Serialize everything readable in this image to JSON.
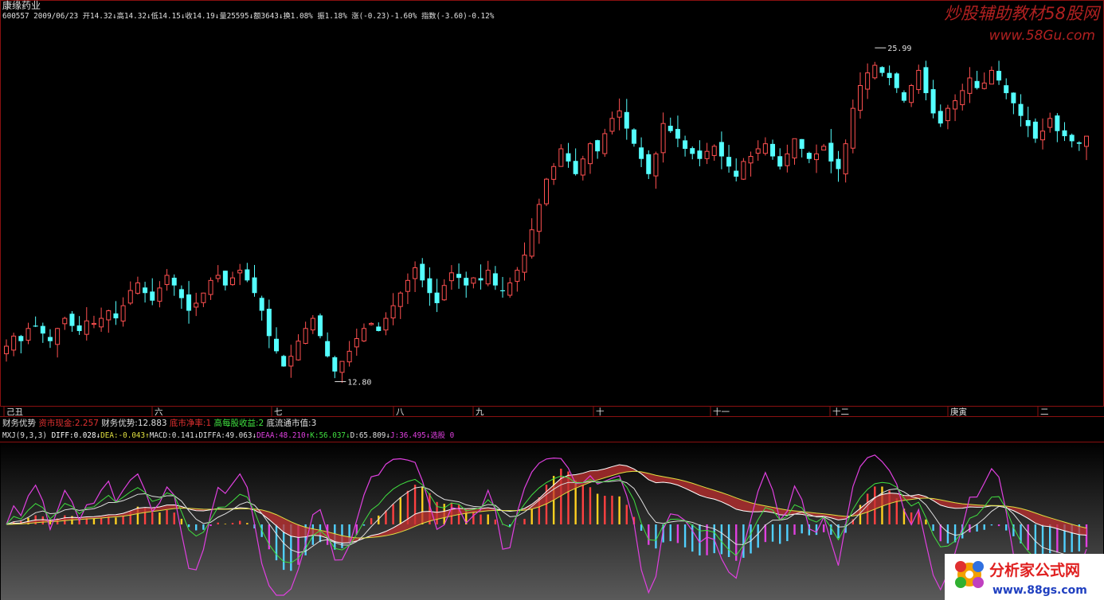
{
  "header": {
    "stock_name": "康缘药业",
    "quote_line": [
      {
        "text": "600557 2009/06/23 ",
        "color": "#e0e0e0"
      },
      {
        "text": "开14.32↓",
        "color": "#e0e0e0"
      },
      {
        "text": "高14.32↓",
        "color": "#e0e0e0"
      },
      {
        "text": "低14.15↓",
        "color": "#e0e0e0"
      },
      {
        "text": "收14.19↓",
        "color": "#e0e0e0"
      },
      {
        "text": "量25595↓",
        "color": "#e0e0e0"
      },
      {
        "text": "额3643↓",
        "color": "#e0e0e0"
      },
      {
        "text": "换1.08% ",
        "color": "#e0e0e0"
      },
      {
        "text": "振1.18% ",
        "color": "#e0e0e0"
      },
      {
        "text": "涨(-0.23)-1.60% ",
        "color": "#e0e0e0"
      },
      {
        "text": "指数(-3.60)-0.12%",
        "color": "#e0e0e0"
      }
    ]
  },
  "watermark": {
    "top_title": "炒股辅助教材58股网",
    "top_url": "www.58Gu.com",
    "bottom_title": "分析家公式网",
    "bottom_url": "www.88gs.com"
  },
  "month_axis": [
    "己丑",
    "六",
    "七",
    "八",
    "九",
    "十",
    "十一",
    "十二",
    "庚寅",
    "二"
  ],
  "finance_line": [
    {
      "text": "财务优势  ",
      "color": "#e0e0e0"
    },
    {
      "text": "资市现金:2.257  ",
      "color": "#e03030"
    },
    {
      "text": "财务优势:12.883  ",
      "color": "#e0e0e0"
    },
    {
      "text": "底市净率:1  ",
      "color": "#e03030"
    },
    {
      "text": "高每股收益:2  ",
      "color": "#40e040"
    },
    {
      "text": "底流通市值:3",
      "color": "#e0e0e0"
    }
  ],
  "indicator_line": [
    {
      "text": "MXJ(9,3,3) ",
      "color": "#e0e0e0"
    },
    {
      "text": "DIFF:0.028↓",
      "color": "#ffffff"
    },
    {
      "text": "DEA:-0.043↑",
      "color": "#e0e040"
    },
    {
      "text": "MACD:0.141↓",
      "color": "#e0e0e0"
    },
    {
      "text": "DIFFA:49.063↓",
      "color": "#e0e0e0"
    },
    {
      "text": "DEAA:48.210↑",
      "color": "#e040e0"
    },
    {
      "text": "K:56.037↓",
      "color": "#40e040"
    },
    {
      "text": "D:65.809↓",
      "color": "#e0e0e0"
    },
    {
      "text": "J:36.495↓",
      "color": "#e040e0"
    },
    {
      "text": "选股 0",
      "color": "#e040e0"
    }
  ],
  "chart_data": [
    {
      "type": "candlestick",
      "price_range": [
        12.0,
        27.0
      ],
      "annotations": [
        {
          "label": "25.99",
          "value": 25.99
        },
        {
          "label": "12.80",
          "value": 12.8
        }
      ],
      "colors": {
        "up": "#ff5050",
        "down": "#54ffff"
      },
      "closes": [
        14.2,
        14.6,
        14.4,
        14.9,
        15.0,
        14.7,
        14.4,
        14.9,
        15.3,
        15.0,
        14.8,
        15.2,
        15.1,
        15.3,
        15.6,
        15.3,
        15.8,
        16.4,
        16.7,
        16.3,
        16.0,
        16.5,
        17.0,
        16.6,
        16.1,
        15.6,
        15.9,
        16.3,
        16.8,
        17.0,
        16.6,
        16.9,
        17.2,
        16.8,
        16.3,
        15.6,
        14.6,
        14.0,
        13.4,
        13.8,
        14.4,
        14.9,
        15.3,
        14.6,
        13.8,
        13.2,
        13.6,
        14.0,
        14.5,
        14.9,
        15.1,
        14.8,
        15.3,
        15.8,
        16.3,
        16.8,
        17.3,
        16.8,
        16.3,
        15.9,
        16.6,
        17.1,
        16.9,
        16.6,
        16.9,
        16.8,
        17.2,
        16.6,
        16.4,
        16.7,
        17.2,
        17.8,
        18.8,
        19.8,
        20.8,
        21.3,
        22.0,
        21.5,
        21.0,
        21.6,
        22.2,
        21.9,
        22.6,
        23.2,
        23.5,
        22.8,
        22.2,
        21.6,
        21.0,
        21.8,
        23.0,
        22.7,
        22.4,
        22.0,
        21.8,
        21.6,
        21.9,
        22.1,
        21.7,
        21.3,
        20.9,
        21.5,
        21.7,
        22.0,
        22.2,
        21.7,
        21.3,
        21.8,
        22.4,
        22.0,
        21.6,
        21.8,
        22.1,
        21.5,
        21.2,
        22.2,
        23.6,
        24.5,
        25.0,
        25.3,
        25.0,
        24.8,
        24.4,
        23.9,
        24.5,
        25.1,
        24.2,
        23.4,
        23.0,
        23.6,
        23.9,
        24.3,
        24.8,
        24.4,
        24.6,
        25.1,
        24.7,
        24.2,
        23.8,
        23.3,
        22.9,
        22.4,
        22.7,
        23.2,
        22.7,
        22.5,
        22.3,
        22.2,
        22.5
      ]
    },
    {
      "type": "indicator",
      "name": "MXJ(9,3,3)",
      "series": [
        {
          "name": "MACD",
          "kind": "bar"
        },
        {
          "name": "DIFF",
          "kind": "line"
        },
        {
          "name": "DEA",
          "kind": "line"
        },
        {
          "name": "K",
          "kind": "line"
        },
        {
          "name": "D",
          "kind": "line"
        },
        {
          "name": "J",
          "kind": "line"
        }
      ]
    }
  ]
}
